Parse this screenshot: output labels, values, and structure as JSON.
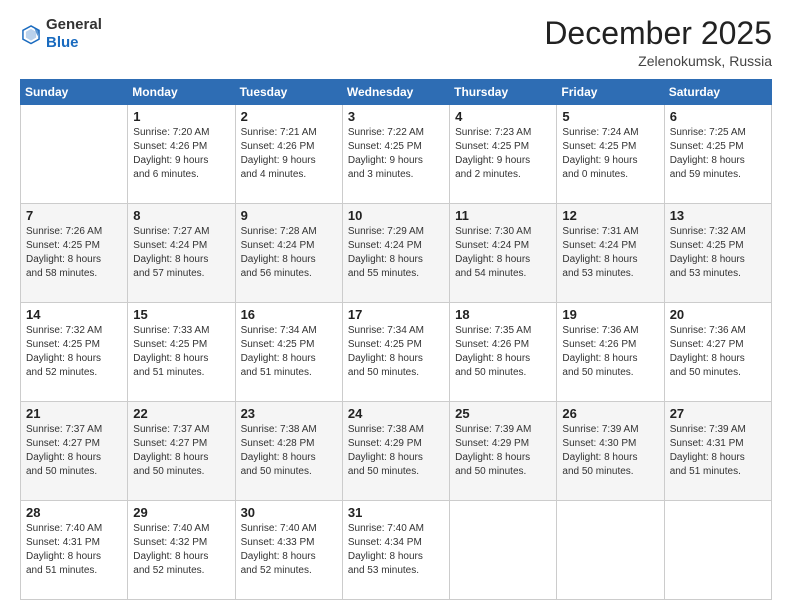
{
  "header": {
    "logo_general": "General",
    "logo_blue": "Blue",
    "month_title": "December 2025",
    "location": "Zelenokumsk, Russia"
  },
  "days_of_week": [
    "Sunday",
    "Monday",
    "Tuesday",
    "Wednesday",
    "Thursday",
    "Friday",
    "Saturday"
  ],
  "weeks": [
    [
      {
        "day": "",
        "info": ""
      },
      {
        "day": "1",
        "info": "Sunrise: 7:20 AM\nSunset: 4:26 PM\nDaylight: 9 hours\nand 6 minutes."
      },
      {
        "day": "2",
        "info": "Sunrise: 7:21 AM\nSunset: 4:26 PM\nDaylight: 9 hours\nand 4 minutes."
      },
      {
        "day": "3",
        "info": "Sunrise: 7:22 AM\nSunset: 4:25 PM\nDaylight: 9 hours\nand 3 minutes."
      },
      {
        "day": "4",
        "info": "Sunrise: 7:23 AM\nSunset: 4:25 PM\nDaylight: 9 hours\nand 2 minutes."
      },
      {
        "day": "5",
        "info": "Sunrise: 7:24 AM\nSunset: 4:25 PM\nDaylight: 9 hours\nand 0 minutes."
      },
      {
        "day": "6",
        "info": "Sunrise: 7:25 AM\nSunset: 4:25 PM\nDaylight: 8 hours\nand 59 minutes."
      }
    ],
    [
      {
        "day": "7",
        "info": "Sunrise: 7:26 AM\nSunset: 4:25 PM\nDaylight: 8 hours\nand 58 minutes."
      },
      {
        "day": "8",
        "info": "Sunrise: 7:27 AM\nSunset: 4:24 PM\nDaylight: 8 hours\nand 57 minutes."
      },
      {
        "day": "9",
        "info": "Sunrise: 7:28 AM\nSunset: 4:24 PM\nDaylight: 8 hours\nand 56 minutes."
      },
      {
        "day": "10",
        "info": "Sunrise: 7:29 AM\nSunset: 4:24 PM\nDaylight: 8 hours\nand 55 minutes."
      },
      {
        "day": "11",
        "info": "Sunrise: 7:30 AM\nSunset: 4:24 PM\nDaylight: 8 hours\nand 54 minutes."
      },
      {
        "day": "12",
        "info": "Sunrise: 7:31 AM\nSunset: 4:24 PM\nDaylight: 8 hours\nand 53 minutes."
      },
      {
        "day": "13",
        "info": "Sunrise: 7:32 AM\nSunset: 4:25 PM\nDaylight: 8 hours\nand 53 minutes."
      }
    ],
    [
      {
        "day": "14",
        "info": "Sunrise: 7:32 AM\nSunset: 4:25 PM\nDaylight: 8 hours\nand 52 minutes."
      },
      {
        "day": "15",
        "info": "Sunrise: 7:33 AM\nSunset: 4:25 PM\nDaylight: 8 hours\nand 51 minutes."
      },
      {
        "day": "16",
        "info": "Sunrise: 7:34 AM\nSunset: 4:25 PM\nDaylight: 8 hours\nand 51 minutes."
      },
      {
        "day": "17",
        "info": "Sunrise: 7:34 AM\nSunset: 4:25 PM\nDaylight: 8 hours\nand 50 minutes."
      },
      {
        "day": "18",
        "info": "Sunrise: 7:35 AM\nSunset: 4:26 PM\nDaylight: 8 hours\nand 50 minutes."
      },
      {
        "day": "19",
        "info": "Sunrise: 7:36 AM\nSunset: 4:26 PM\nDaylight: 8 hours\nand 50 minutes."
      },
      {
        "day": "20",
        "info": "Sunrise: 7:36 AM\nSunset: 4:27 PM\nDaylight: 8 hours\nand 50 minutes."
      }
    ],
    [
      {
        "day": "21",
        "info": "Sunrise: 7:37 AM\nSunset: 4:27 PM\nDaylight: 8 hours\nand 50 minutes."
      },
      {
        "day": "22",
        "info": "Sunrise: 7:37 AM\nSunset: 4:27 PM\nDaylight: 8 hours\nand 50 minutes."
      },
      {
        "day": "23",
        "info": "Sunrise: 7:38 AM\nSunset: 4:28 PM\nDaylight: 8 hours\nand 50 minutes."
      },
      {
        "day": "24",
        "info": "Sunrise: 7:38 AM\nSunset: 4:29 PM\nDaylight: 8 hours\nand 50 minutes."
      },
      {
        "day": "25",
        "info": "Sunrise: 7:39 AM\nSunset: 4:29 PM\nDaylight: 8 hours\nand 50 minutes."
      },
      {
        "day": "26",
        "info": "Sunrise: 7:39 AM\nSunset: 4:30 PM\nDaylight: 8 hours\nand 50 minutes."
      },
      {
        "day": "27",
        "info": "Sunrise: 7:39 AM\nSunset: 4:31 PM\nDaylight: 8 hours\nand 51 minutes."
      }
    ],
    [
      {
        "day": "28",
        "info": "Sunrise: 7:40 AM\nSunset: 4:31 PM\nDaylight: 8 hours\nand 51 minutes."
      },
      {
        "day": "29",
        "info": "Sunrise: 7:40 AM\nSunset: 4:32 PM\nDaylight: 8 hours\nand 52 minutes."
      },
      {
        "day": "30",
        "info": "Sunrise: 7:40 AM\nSunset: 4:33 PM\nDaylight: 8 hours\nand 52 minutes."
      },
      {
        "day": "31",
        "info": "Sunrise: 7:40 AM\nSunset: 4:34 PM\nDaylight: 8 hours\nand 53 minutes."
      },
      {
        "day": "",
        "info": ""
      },
      {
        "day": "",
        "info": ""
      },
      {
        "day": "",
        "info": ""
      }
    ]
  ]
}
